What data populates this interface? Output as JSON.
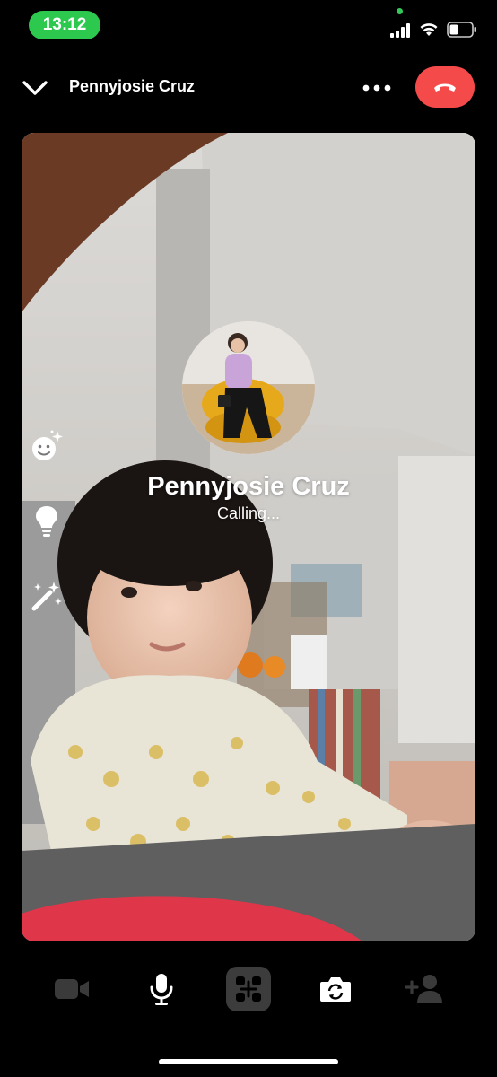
{
  "status_bar": {
    "time": "13:12"
  },
  "header": {
    "contact_name": "Pennyjosie Cruz"
  },
  "call": {
    "name": "Pennyjosie Cruz",
    "status": "Calling..."
  },
  "icons": {
    "back": "chevron-down-icon",
    "more": "more-dots-icon",
    "end_call": "phone-hangup-icon",
    "effects": "face-sparkle-icon",
    "light": "lightbulb-icon",
    "filters": "magic-wand-icon",
    "video": "video-camera-icon",
    "mic": "microphone-icon",
    "share": "share-screen-icon",
    "flip": "camera-flip-icon",
    "add_person": "add-person-icon"
  },
  "colors": {
    "status_green": "#2dc94f",
    "end_call_red": "#f44a4a",
    "disabled_grey": "#3a3a3a"
  }
}
